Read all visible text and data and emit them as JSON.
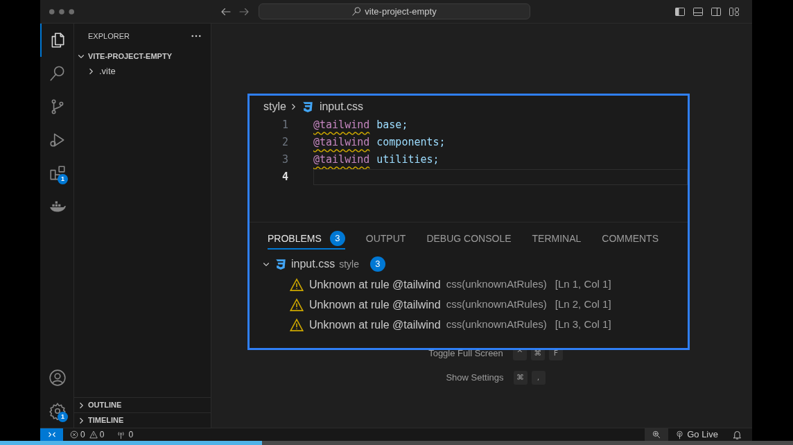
{
  "title_bar": {
    "search": "vite-project-empty"
  },
  "activity_bar": {
    "top": [
      {
        "kind": "explorer",
        "selected": true
      },
      {
        "kind": "search",
        "selected": false
      },
      {
        "kind": "source-control",
        "selected": false
      },
      {
        "kind": "run-debug",
        "selected": false
      },
      {
        "kind": "extensions",
        "selected": false,
        "badge": "1"
      },
      {
        "kind": "docker",
        "selected": false
      }
    ],
    "bottom": [
      {
        "kind": "account"
      },
      {
        "kind": "settings",
        "badge": "1"
      }
    ]
  },
  "sidebar": {
    "title": "EXPLORER",
    "folder": {
      "name": "VITE-PROJECT-EMPTY",
      "expanded": true,
      "children": [
        {
          "name": ".vite",
          "expanded": false
        }
      ]
    },
    "sections": [
      {
        "name": "OUTLINE",
        "expanded": false
      },
      {
        "name": "TIMELINE",
        "expanded": false
      }
    ]
  },
  "editor": {
    "shortcuts": [
      {
        "label": "Toggle Full Screen",
        "keys": [
          "^",
          "⌘",
          "F"
        ]
      },
      {
        "label": "Show Settings",
        "keys": [
          "⌘",
          ","
        ]
      }
    ]
  },
  "overlay": {
    "breadcrumb": {
      "folder": "style",
      "file": "input.css"
    },
    "lines": [
      {
        "number": "1",
        "at_rule": "@tailwind",
        "value": "base;",
        "warning": true,
        "current": false
      },
      {
        "number": "2",
        "at_rule": "@tailwind",
        "value": "components;",
        "warning": true,
        "current": false
      },
      {
        "number": "3",
        "at_rule": "@tailwind",
        "value": "utilities;",
        "warning": true,
        "current": false
      },
      {
        "number": "4",
        "current": true
      }
    ],
    "panel_tabs": [
      {
        "label": "PROBLEMS",
        "badge": "3",
        "selected": true
      },
      {
        "label": "OUTPUT",
        "selected": false
      },
      {
        "label": "DEBUG CONSOLE",
        "selected": false
      },
      {
        "label": "TERMINAL",
        "selected": false
      },
      {
        "label": "COMMENTS",
        "selected": false
      }
    ],
    "problems": {
      "file": "input.css",
      "folder": "style",
      "count": "3",
      "expanded": true,
      "items": [
        {
          "message": "Unknown at rule @tailwind",
          "source": "css(unknownAtRules)",
          "location": "[Ln 1, Col 1]",
          "kind": "warning"
        },
        {
          "message": "Unknown at rule @tailwind",
          "source": "css(unknownAtRules)",
          "location": "[Ln 2, Col 1]",
          "kind": "warning"
        },
        {
          "message": "Unknown at rule @tailwind",
          "source": "css(unknownAtRules)",
          "location": "[Ln 3, Col 1]",
          "kind": "warning"
        }
      ]
    }
  },
  "status_bar": {
    "errors": "0",
    "warnings": "0",
    "ports": "0",
    "go_live": "Go Live"
  },
  "video_progress": {
    "level": 0.33
  }
}
